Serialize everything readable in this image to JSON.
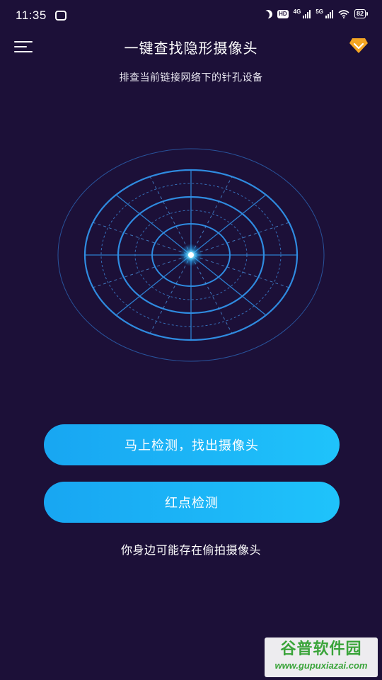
{
  "status_bar": {
    "time": "11:35",
    "hd_label": "HD",
    "net1_label": "4G",
    "net2_label": "5G",
    "battery": "82"
  },
  "header": {
    "title": "一键查找隐形摄像头",
    "subtitle": "排查当前链接网络下的针孔设备"
  },
  "actions": {
    "detect_button": "马上检测，找出摄像头",
    "red_dot_button": "红点检测"
  },
  "footer": {
    "warning": "你身边可能存在偷拍摄像头"
  },
  "watermark": {
    "name": "谷普软件园",
    "url": "www.gupuxiazai.com"
  },
  "colors": {
    "background": "#1c1038",
    "button_gradient_start": "#18a6f2",
    "button_gradient_end": "#1fc3fb",
    "radar_line": "#2f8be0",
    "vip_badge": "#f5a623"
  },
  "icons": {
    "menu": "menu-icon",
    "vip": "vip-diamond-icon",
    "radar": "radar-scanner-icon"
  }
}
